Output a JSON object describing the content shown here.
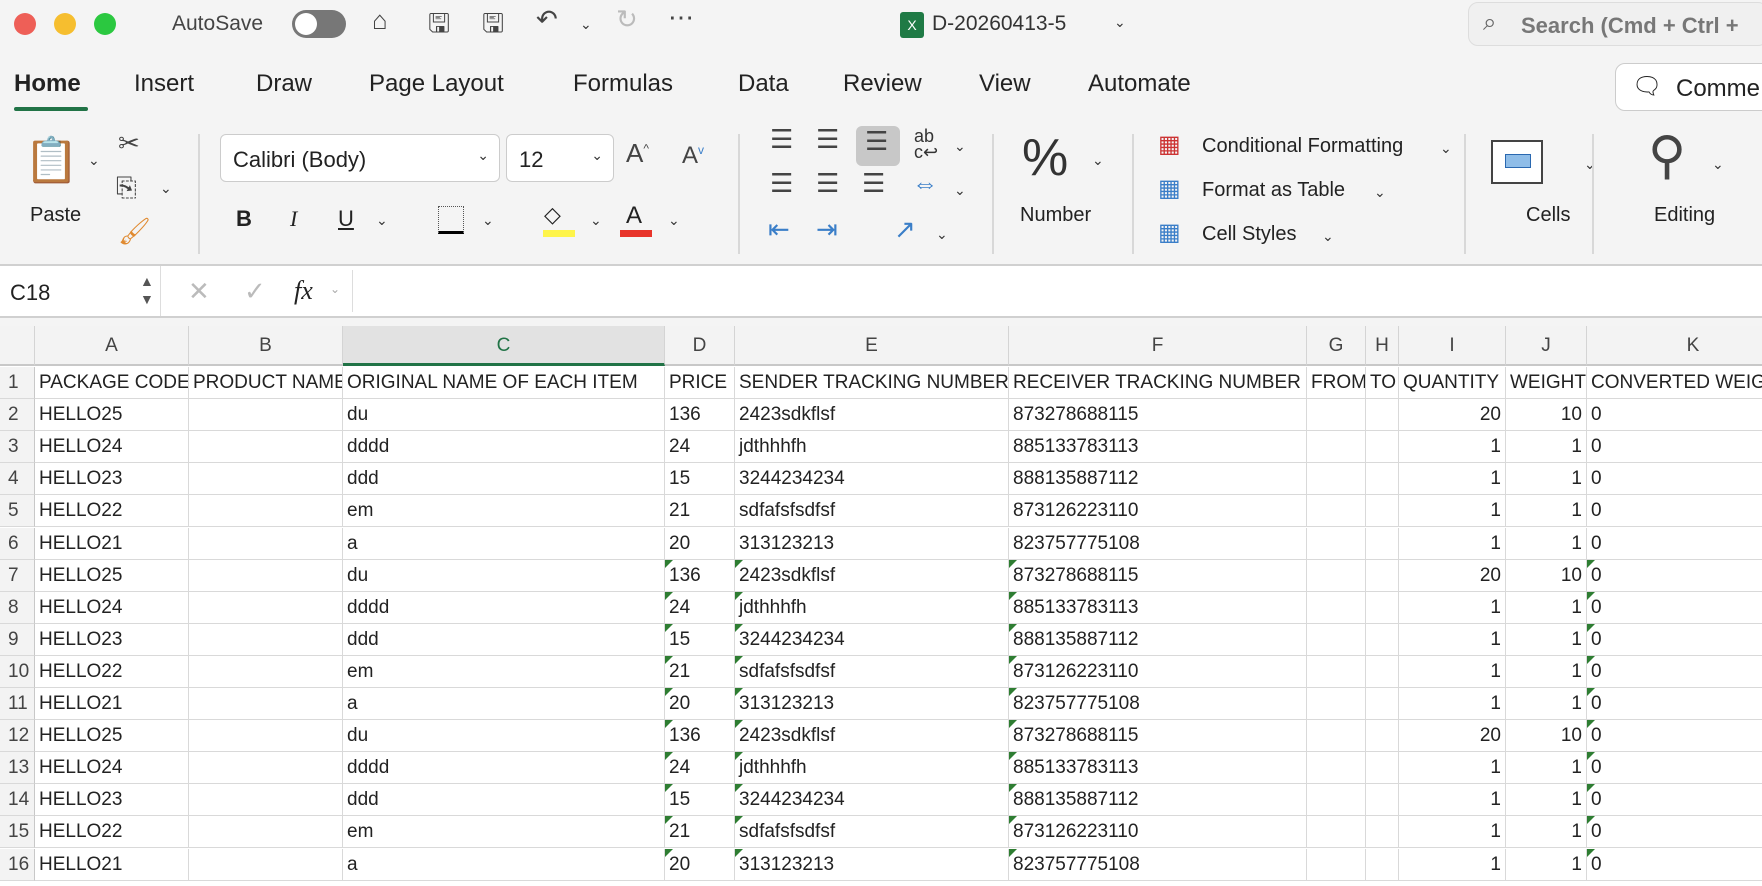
{
  "titlebar": {
    "autosave": "AutoSave",
    "filename": "D-20260413-5",
    "search_placeholder": "Search (Cmd + Ctrl +"
  },
  "tabs": [
    "Home",
    "Insert",
    "Draw",
    "Page Layout",
    "Formulas",
    "Data",
    "Review",
    "View",
    "Automate"
  ],
  "comments_label": "Comme",
  "ribbon": {
    "paste": "Paste",
    "font": "Calibri (Body)",
    "size": "12",
    "bold": "B",
    "italic": "I",
    "underline": "U",
    "number": "Number",
    "cond_fmt": "Conditional Formatting",
    "fmt_table": "Format as Table",
    "cell_styles": "Cell Styles",
    "cells": "Cells",
    "editing": "Editing"
  },
  "formula": {
    "name_box": "C18",
    "fx": "fx",
    "value": ""
  },
  "columns": [
    "A",
    "B",
    "C",
    "D",
    "E",
    "F",
    "G",
    "H",
    "I",
    "J",
    "K"
  ],
  "selected_column": "C",
  "rows": [
    [
      "PACKAGE CODE",
      "PRODUCT NAME",
      "ORIGINAL NAME OF EACH ITEM",
      "PRICE",
      "SENDER TRACKING NUMBER",
      "RECEIVER TRACKING NUMBER",
      "FROM",
      "TO",
      "QUANTITY",
      "WEIGHT",
      "CONVERTED WEIGHT"
    ],
    [
      "HELLO25",
      "",
      "du",
      "136",
      "2423sdkflsf",
      "873278688115",
      "",
      "",
      "20",
      "10",
      "0"
    ],
    [
      "HELLO24",
      "",
      "dddd",
      "24",
      "jdthhhfh",
      "885133783113",
      "",
      "",
      "1",
      "1",
      "0"
    ],
    [
      "HELLO23",
      "",
      "ddd",
      "15",
      "3244234234",
      "888135887112",
      "",
      "",
      "1",
      "1",
      "0"
    ],
    [
      "HELLO22",
      "",
      "em",
      "21",
      "sdfafsfsdfsf",
      "873126223110",
      "",
      "",
      "1",
      "1",
      "0"
    ],
    [
      "HELLO21",
      "",
      "a",
      "20",
      "313123213",
      "823757775108",
      "",
      "",
      "1",
      "1",
      "0"
    ],
    [
      "HELLO25",
      "",
      "du",
      "136",
      "2423sdkflsf",
      "873278688115",
      "",
      "",
      "20",
      "10",
      "0"
    ],
    [
      "HELLO24",
      "",
      "dddd",
      "24",
      "jdthhhfh",
      "885133783113",
      "",
      "",
      "1",
      "1",
      "0"
    ],
    [
      "HELLO23",
      "",
      "ddd",
      "15",
      "3244234234",
      "888135887112",
      "",
      "",
      "1",
      "1",
      "0"
    ],
    [
      "HELLO22",
      "",
      "em",
      "21",
      "sdfafsfsdfsf",
      "873126223110",
      "",
      "",
      "1",
      "1",
      "0"
    ],
    [
      "HELLO21",
      "",
      "a",
      "20",
      "313123213",
      "823757775108",
      "",
      "",
      "1",
      "1",
      "0"
    ],
    [
      "HELLO25",
      "",
      "du",
      "136",
      "2423sdkflsf",
      "873278688115",
      "",
      "",
      "20",
      "10",
      "0"
    ],
    [
      "HELLO24",
      "",
      "dddd",
      "24",
      "jdthhhfh",
      "885133783113",
      "",
      "",
      "1",
      "1",
      "0"
    ],
    [
      "HELLO23",
      "",
      "ddd",
      "15",
      "3244234234",
      "888135887112",
      "",
      "",
      "1",
      "1",
      "0"
    ],
    [
      "HELLO22",
      "",
      "em",
      "21",
      "sdfafsfsdfsf",
      "873126223110",
      "",
      "",
      "1",
      "1",
      "0"
    ],
    [
      "HELLO21",
      "",
      "a",
      "20",
      "313123213",
      "823757775108",
      "",
      "",
      "1",
      "1",
      "0"
    ]
  ]
}
